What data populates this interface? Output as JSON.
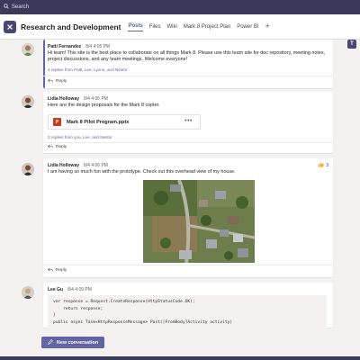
{
  "search": {
    "label": "Search"
  },
  "channel": {
    "title": "Research and Development",
    "tabs": [
      {
        "label": "Posts"
      },
      {
        "label": "Files"
      },
      {
        "label": "Wiki"
      },
      {
        "label": "Mark 8 Project Plan"
      },
      {
        "label": "Power BI"
      }
    ],
    "add_tab": "+"
  },
  "posts": [
    {
      "author": "Patti Fernandez",
      "time": "8/4 4:05 PM",
      "text": "Hi team! This site is the best place to collaborate on all things Mark 8. Please use this team site for doc repository, meeting notes, project discussions, and any team meetings. Welcome everyone!",
      "replies": "4 replies from Patti, Lee, Lynne, and Nestor",
      "reply_label": "Reply"
    },
    {
      "author": "Lidia Holloway",
      "time": "8/4 4:05 PM",
      "text": "Here are the design proposals for the Mark 8 copter.",
      "file": {
        "name": "Mark 8 Pilot Program.pptx",
        "icon_letter": "P",
        "more": "•••"
      },
      "replies": "3 replies from you, Lee, and Nestor",
      "reply_label": "Reply"
    },
    {
      "author": "Lidia Holloway",
      "time": "8/4 4:06 PM",
      "text": "I am having so much fun with the prototype. Check out this overhead view of my house.",
      "reaction": {
        "icon": "thumbs-up",
        "count": "3"
      },
      "reply_label": "Reply"
    },
    {
      "author": "Lee Gu",
      "time": "8/4 4:09 PM",
      "code": "var response = Request.CreateResponse(HttpStatusCode.OK);\n    return response;\n}\npublic async Task<HttpResponseMessage> Post([FromBody]Activity activity)"
    }
  ],
  "new_conversation": {
    "label": "New conversation"
  },
  "colors": {
    "accent": "#6264a7",
    "topbar": "#3b3a5a",
    "background": "#f3f2f1"
  }
}
